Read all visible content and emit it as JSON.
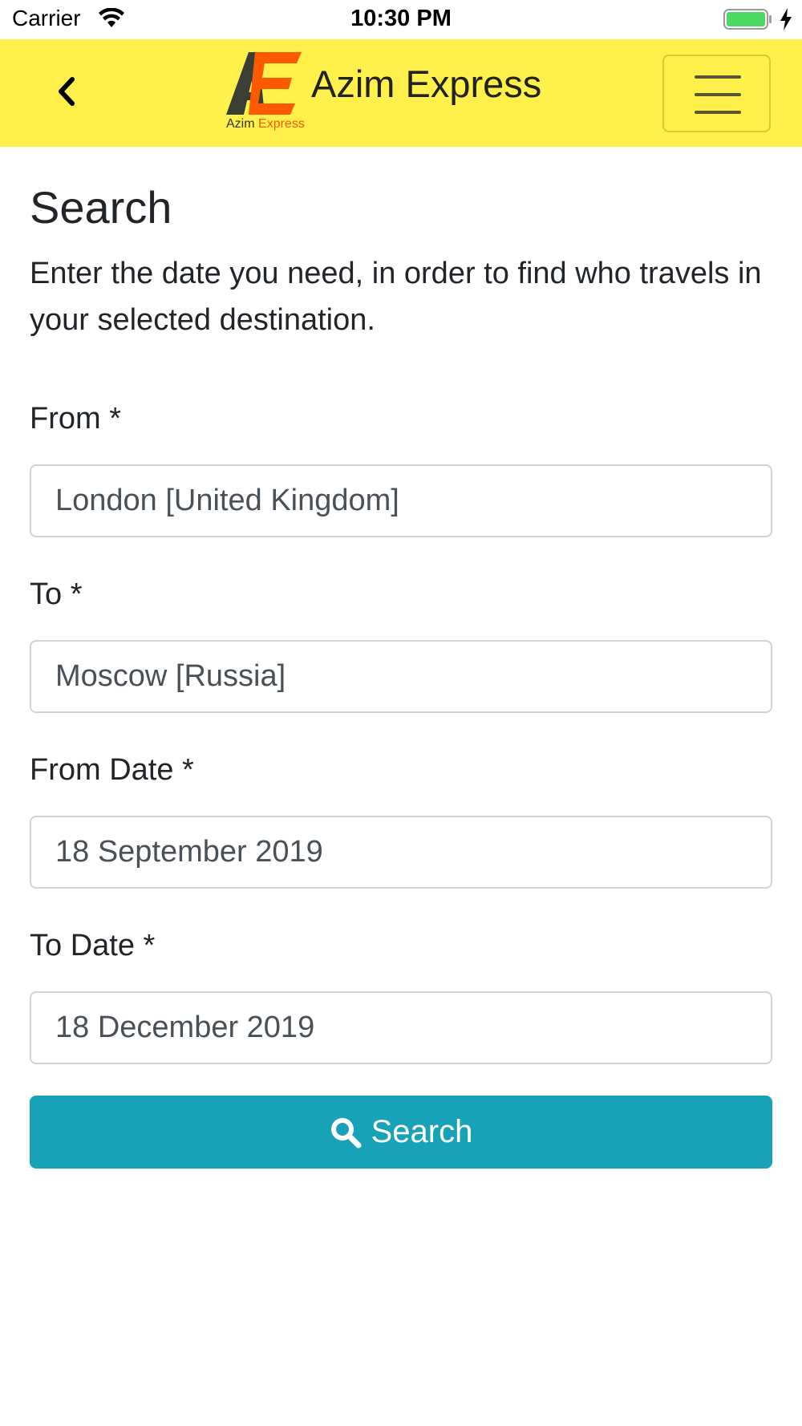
{
  "status_bar": {
    "carrier": "Carrier",
    "time": "10:30 PM",
    "battery_color": "#4cd964"
  },
  "navbar": {
    "background": "#fff04c",
    "brand_title": "Azim Express",
    "logo_caption_1": "Azim",
    "logo_caption_2": "Express",
    "logo_letters": "AE",
    "back_icon": "chevron-left-icon",
    "menu_icon": "hamburger-menu-icon"
  },
  "page": {
    "title": "Search",
    "description": "Enter the date you need, in order to find who travels in your selected destination."
  },
  "form": {
    "from": {
      "label": "From *",
      "value": "London [United Kingdom]"
    },
    "to": {
      "label": "To *",
      "value": "Moscow [Russia]"
    },
    "from_date": {
      "label": "From Date *",
      "value": "18 September 2019"
    },
    "to_date": {
      "label": "To Date *",
      "value": "18 December 2019"
    },
    "submit": {
      "label": "Search",
      "icon": "search-icon",
      "color": "#17a2b8"
    }
  }
}
